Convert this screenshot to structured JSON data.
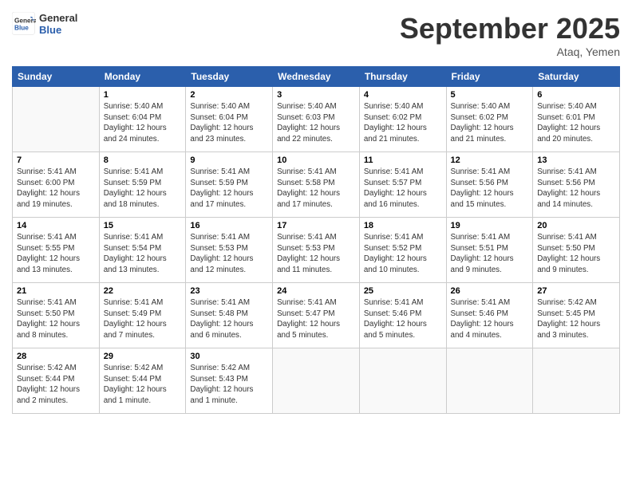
{
  "header": {
    "logo_line1": "General",
    "logo_line2": "Blue",
    "month_title": "September 2025",
    "location": "Ataq, Yemen"
  },
  "weekdays": [
    "Sunday",
    "Monday",
    "Tuesday",
    "Wednesday",
    "Thursday",
    "Friday",
    "Saturday"
  ],
  "weeks": [
    [
      {
        "day": "",
        "info": ""
      },
      {
        "day": "1",
        "info": "Sunrise: 5:40 AM\nSunset: 6:04 PM\nDaylight: 12 hours\nand 24 minutes."
      },
      {
        "day": "2",
        "info": "Sunrise: 5:40 AM\nSunset: 6:04 PM\nDaylight: 12 hours\nand 23 minutes."
      },
      {
        "day": "3",
        "info": "Sunrise: 5:40 AM\nSunset: 6:03 PM\nDaylight: 12 hours\nand 22 minutes."
      },
      {
        "day": "4",
        "info": "Sunrise: 5:40 AM\nSunset: 6:02 PM\nDaylight: 12 hours\nand 21 minutes."
      },
      {
        "day": "5",
        "info": "Sunrise: 5:40 AM\nSunset: 6:02 PM\nDaylight: 12 hours\nand 21 minutes."
      },
      {
        "day": "6",
        "info": "Sunrise: 5:40 AM\nSunset: 6:01 PM\nDaylight: 12 hours\nand 20 minutes."
      }
    ],
    [
      {
        "day": "7",
        "info": "Sunrise: 5:41 AM\nSunset: 6:00 PM\nDaylight: 12 hours\nand 19 minutes."
      },
      {
        "day": "8",
        "info": "Sunrise: 5:41 AM\nSunset: 5:59 PM\nDaylight: 12 hours\nand 18 minutes."
      },
      {
        "day": "9",
        "info": "Sunrise: 5:41 AM\nSunset: 5:59 PM\nDaylight: 12 hours\nand 17 minutes."
      },
      {
        "day": "10",
        "info": "Sunrise: 5:41 AM\nSunset: 5:58 PM\nDaylight: 12 hours\nand 17 minutes."
      },
      {
        "day": "11",
        "info": "Sunrise: 5:41 AM\nSunset: 5:57 PM\nDaylight: 12 hours\nand 16 minutes."
      },
      {
        "day": "12",
        "info": "Sunrise: 5:41 AM\nSunset: 5:56 PM\nDaylight: 12 hours\nand 15 minutes."
      },
      {
        "day": "13",
        "info": "Sunrise: 5:41 AM\nSunset: 5:56 PM\nDaylight: 12 hours\nand 14 minutes."
      }
    ],
    [
      {
        "day": "14",
        "info": "Sunrise: 5:41 AM\nSunset: 5:55 PM\nDaylight: 12 hours\nand 13 minutes."
      },
      {
        "day": "15",
        "info": "Sunrise: 5:41 AM\nSunset: 5:54 PM\nDaylight: 12 hours\nand 13 minutes."
      },
      {
        "day": "16",
        "info": "Sunrise: 5:41 AM\nSunset: 5:53 PM\nDaylight: 12 hours\nand 12 minutes."
      },
      {
        "day": "17",
        "info": "Sunrise: 5:41 AM\nSunset: 5:53 PM\nDaylight: 12 hours\nand 11 minutes."
      },
      {
        "day": "18",
        "info": "Sunrise: 5:41 AM\nSunset: 5:52 PM\nDaylight: 12 hours\nand 10 minutes."
      },
      {
        "day": "19",
        "info": "Sunrise: 5:41 AM\nSunset: 5:51 PM\nDaylight: 12 hours\nand 9 minutes."
      },
      {
        "day": "20",
        "info": "Sunrise: 5:41 AM\nSunset: 5:50 PM\nDaylight: 12 hours\nand 9 minutes."
      }
    ],
    [
      {
        "day": "21",
        "info": "Sunrise: 5:41 AM\nSunset: 5:50 PM\nDaylight: 12 hours\nand 8 minutes."
      },
      {
        "day": "22",
        "info": "Sunrise: 5:41 AM\nSunset: 5:49 PM\nDaylight: 12 hours\nand 7 minutes."
      },
      {
        "day": "23",
        "info": "Sunrise: 5:41 AM\nSunset: 5:48 PM\nDaylight: 12 hours\nand 6 minutes."
      },
      {
        "day": "24",
        "info": "Sunrise: 5:41 AM\nSunset: 5:47 PM\nDaylight: 12 hours\nand 5 minutes."
      },
      {
        "day": "25",
        "info": "Sunrise: 5:41 AM\nSunset: 5:46 PM\nDaylight: 12 hours\nand 5 minutes."
      },
      {
        "day": "26",
        "info": "Sunrise: 5:41 AM\nSunset: 5:46 PM\nDaylight: 12 hours\nand 4 minutes."
      },
      {
        "day": "27",
        "info": "Sunrise: 5:42 AM\nSunset: 5:45 PM\nDaylight: 12 hours\nand 3 minutes."
      }
    ],
    [
      {
        "day": "28",
        "info": "Sunrise: 5:42 AM\nSunset: 5:44 PM\nDaylight: 12 hours\nand 2 minutes."
      },
      {
        "day": "29",
        "info": "Sunrise: 5:42 AM\nSunset: 5:44 PM\nDaylight: 12 hours\nand 1 minute."
      },
      {
        "day": "30",
        "info": "Sunrise: 5:42 AM\nSunset: 5:43 PM\nDaylight: 12 hours\nand 1 minute."
      },
      {
        "day": "",
        "info": ""
      },
      {
        "day": "",
        "info": ""
      },
      {
        "day": "",
        "info": ""
      },
      {
        "day": "",
        "info": ""
      }
    ]
  ]
}
